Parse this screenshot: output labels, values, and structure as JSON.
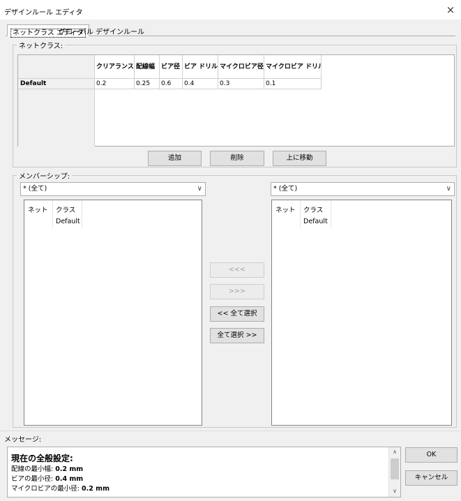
{
  "window": {
    "title": "デザインルール エディタ",
    "close_glyph": "×"
  },
  "tabs": [
    {
      "label": "ネットクラス エディタ",
      "active": true
    },
    {
      "label": "グローバル デザインルール",
      "active": false
    }
  ],
  "netclasses": {
    "group_label": "ネットクラス:",
    "columns": [
      "クリアランス",
      "配線幅",
      "ビア径",
      "ビア ドリル",
      "マイクロビア径",
      "マイクロビア ドリル"
    ],
    "rows": [
      {
        "name": "Default",
        "values": [
          "0.2",
          "0.25",
          "0.6",
          "0.4",
          "0.3",
          "0.1"
        ]
      }
    ],
    "buttons": {
      "add": "追加",
      "delete": "削除",
      "move_up": "上に移動"
    }
  },
  "membership": {
    "group_label": "メンバーシップ:",
    "left_filter": "* (全て)",
    "right_filter": "* (全て)",
    "list_headers": {
      "net": "ネット",
      "class": "クラス"
    },
    "left_rows": [
      {
        "net": "",
        "class": "Default"
      }
    ],
    "right_rows": [
      {
        "net": "",
        "class": "Default"
      }
    ],
    "buttons": {
      "move_left": "<<<",
      "move_right": ">>>",
      "select_all_left": "<< 全て選択",
      "select_all_right": "全て選択 >>"
    }
  },
  "messages": {
    "label": "メッセージ:",
    "heading": "現在の全般設定:",
    "lines": [
      {
        "label": "配線の最小幅:",
        "value": "0.2 mm"
      },
      {
        "label": "ビアの最小径:",
        "value": "0.4 mm"
      },
      {
        "label": "マイクロビアの最小径:",
        "value": "0.2 mm"
      }
    ]
  },
  "dialog_buttons": {
    "ok": "OK",
    "cancel": "キャンセル"
  }
}
